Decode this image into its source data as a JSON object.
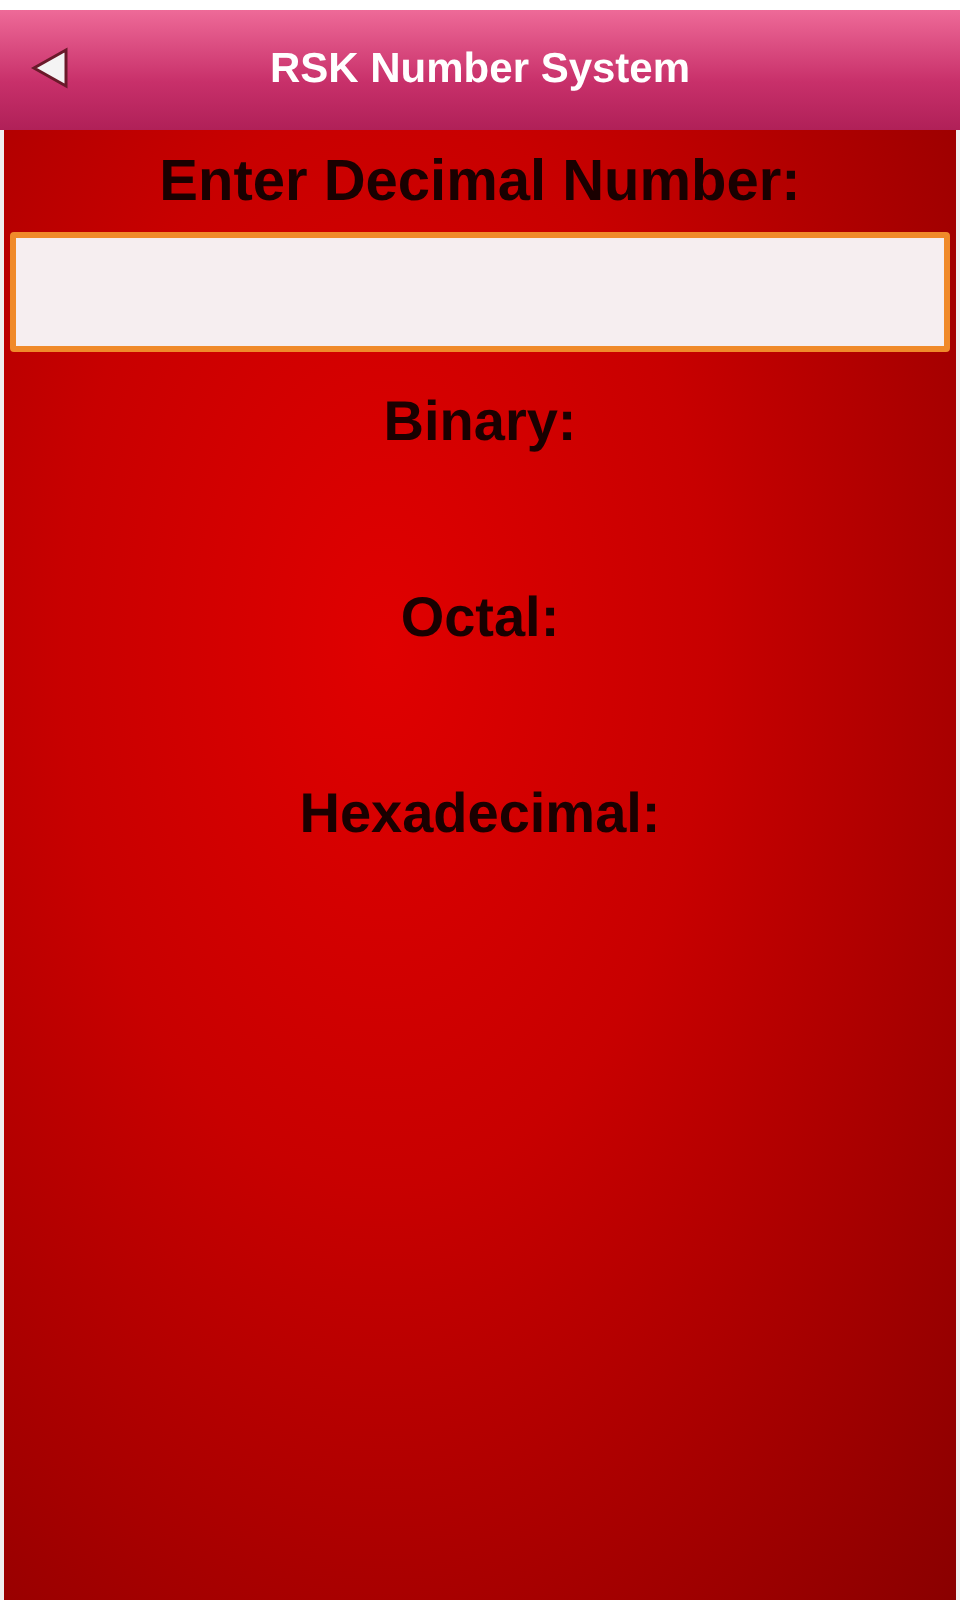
{
  "header": {
    "title": "RSK Number System"
  },
  "decimal_input": {
    "label": "Enter Decimal Number:",
    "focused": true
  },
  "results": [
    {
      "label": "Binary:"
    },
    {
      "label": "Octal:"
    },
    {
      "label": "Hexadecimal:"
    }
  ]
}
